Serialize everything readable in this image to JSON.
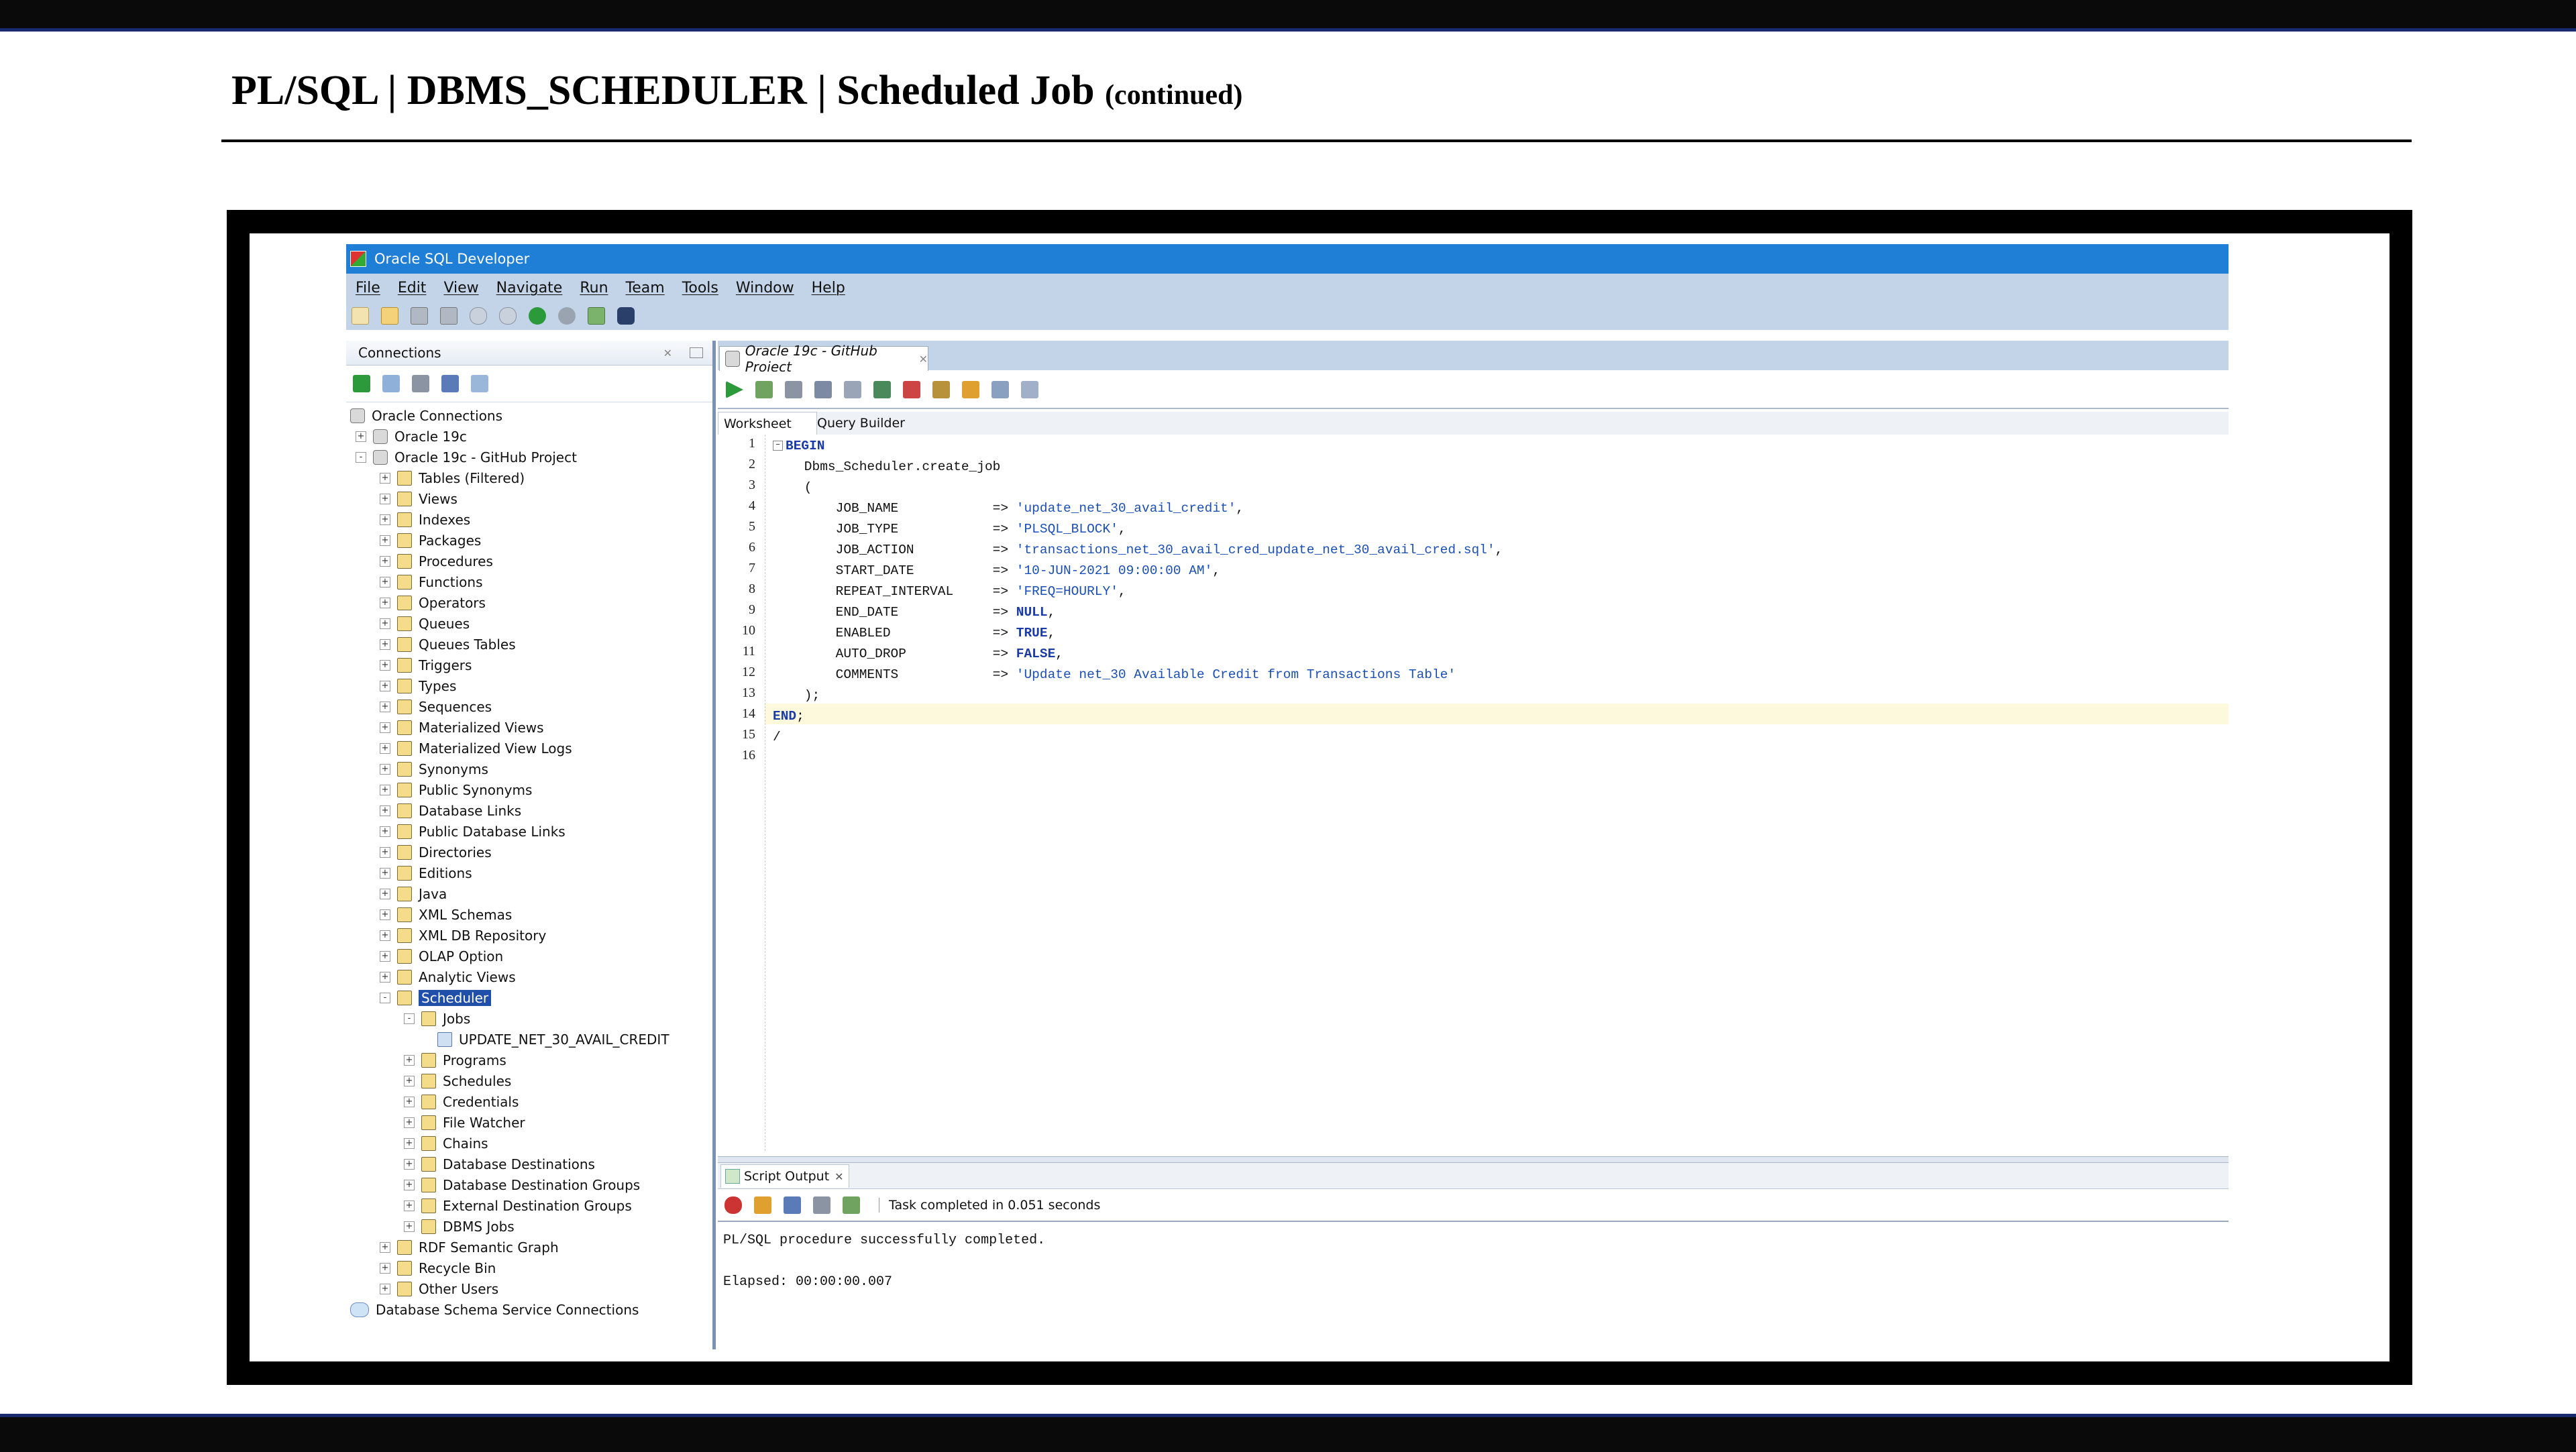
{
  "slide": {
    "title": "PL/SQL | DBMS_SCHEDULER | Scheduled Job",
    "title_suffix": "(continued)"
  },
  "app": {
    "window_title": "Oracle SQL Developer",
    "menu": [
      "File",
      "Edit",
      "View",
      "Navigate",
      "Run",
      "Team",
      "Tools",
      "Window",
      "Help"
    ]
  },
  "connections_panel": {
    "title": "Connections",
    "tree": [
      {
        "label": "Oracle Connections",
        "level": 0,
        "icon": "database-icon",
        "expander": ""
      },
      {
        "label": "Oracle 19c",
        "level": 1,
        "icon": "database-icon",
        "expander": "+"
      },
      {
        "label": "Oracle 19c - GitHub Project",
        "level": 1,
        "icon": "database-icon",
        "expander": "-"
      },
      {
        "label": "Tables (Filtered)",
        "level": 2,
        "icon": "folder-icon",
        "expander": "+"
      },
      {
        "label": "Views",
        "level": 2,
        "icon": "folder-icon",
        "expander": "+"
      },
      {
        "label": "Indexes",
        "level": 2,
        "icon": "folder-icon",
        "expander": "+"
      },
      {
        "label": "Packages",
        "level": 2,
        "icon": "folder-icon",
        "expander": "+"
      },
      {
        "label": "Procedures",
        "level": 2,
        "icon": "folder-icon",
        "expander": "+"
      },
      {
        "label": "Functions",
        "level": 2,
        "icon": "folder-icon",
        "expander": "+"
      },
      {
        "label": "Operators",
        "level": 2,
        "icon": "folder-icon",
        "expander": "+"
      },
      {
        "label": "Queues",
        "level": 2,
        "icon": "folder-icon",
        "expander": "+"
      },
      {
        "label": "Queues Tables",
        "level": 2,
        "icon": "folder-icon",
        "expander": "+"
      },
      {
        "label": "Triggers",
        "level": 2,
        "icon": "folder-icon",
        "expander": "+"
      },
      {
        "label": "Types",
        "level": 2,
        "icon": "folder-icon",
        "expander": "+"
      },
      {
        "label": "Sequences",
        "level": 2,
        "icon": "folder-icon",
        "expander": "+"
      },
      {
        "label": "Materialized Views",
        "level": 2,
        "icon": "folder-icon",
        "expander": "+"
      },
      {
        "label": "Materialized View Logs",
        "level": 2,
        "icon": "folder-icon",
        "expander": "+"
      },
      {
        "label": "Synonyms",
        "level": 2,
        "icon": "folder-icon",
        "expander": "+"
      },
      {
        "label": "Public Synonyms",
        "level": 2,
        "icon": "folder-icon",
        "expander": "+"
      },
      {
        "label": "Database Links",
        "level": 2,
        "icon": "folder-icon",
        "expander": "+"
      },
      {
        "label": "Public Database Links",
        "level": 2,
        "icon": "folder-icon",
        "expander": "+"
      },
      {
        "label": "Directories",
        "level": 2,
        "icon": "folder-icon",
        "expander": "+"
      },
      {
        "label": "Editions",
        "level": 2,
        "icon": "folder-icon",
        "expander": "+"
      },
      {
        "label": "Java",
        "level": 2,
        "icon": "folder-icon",
        "expander": "+"
      },
      {
        "label": "XML Schemas",
        "level": 2,
        "icon": "folder-icon",
        "expander": "+"
      },
      {
        "label": "XML DB Repository",
        "level": 2,
        "icon": "folder-icon",
        "expander": "+"
      },
      {
        "label": "OLAP Option",
        "level": 2,
        "icon": "folder-icon",
        "expander": "+"
      },
      {
        "label": "Analytic Views",
        "level": 2,
        "icon": "folder-icon",
        "expander": "+"
      },
      {
        "label": "Scheduler",
        "level": 2,
        "icon": "folder-icon",
        "expander": "-",
        "selected": true
      },
      {
        "label": "Jobs",
        "level": 3,
        "icon": "folder-icon",
        "expander": "-"
      },
      {
        "label": "UPDATE_NET_30_AVAIL_CREDIT",
        "level": 4,
        "icon": "job-icon",
        "expander": ""
      },
      {
        "label": "Programs",
        "level": 3,
        "icon": "folder-icon",
        "expander": "+"
      },
      {
        "label": "Schedules",
        "level": 3,
        "icon": "folder-icon",
        "expander": "+"
      },
      {
        "label": "Credentials",
        "level": 3,
        "icon": "folder-icon",
        "expander": "+"
      },
      {
        "label": "File Watcher",
        "level": 3,
        "icon": "folder-icon",
        "expander": "+"
      },
      {
        "label": "Chains",
        "level": 3,
        "icon": "folder-icon",
        "expander": "+"
      },
      {
        "label": "Database Destinations",
        "level": 3,
        "icon": "folder-icon",
        "expander": "+"
      },
      {
        "label": "Database Destination Groups",
        "level": 3,
        "icon": "folder-icon",
        "expander": "+"
      },
      {
        "label": "External Destination Groups",
        "level": 3,
        "icon": "folder-icon",
        "expander": "+"
      },
      {
        "label": "DBMS Jobs",
        "level": 3,
        "icon": "folder-icon",
        "expander": "+"
      },
      {
        "label": "RDF Semantic Graph",
        "level": 2,
        "icon": "folder-icon",
        "expander": "+"
      },
      {
        "label": "Recycle Bin",
        "level": 2,
        "icon": "folder-icon",
        "expander": "+"
      },
      {
        "label": "Other Users",
        "level": 2,
        "icon": "folder-icon",
        "expander": "+"
      },
      {
        "label": "Database Schema Service Connections",
        "level": 0,
        "icon": "cloud-icon",
        "expander": ""
      }
    ]
  },
  "editor": {
    "tab_label": "Oracle 19c - GitHub Project",
    "subtabs": [
      "Worksheet",
      "Query Builder"
    ],
    "code_lines": [
      "BEGIN",
      "    Dbms_Scheduler.create_job",
      "    (",
      "        JOB_NAME            => 'update_net_30_avail_credit',",
      "        JOB_TYPE            => 'PLSQL_BLOCK',",
      "        JOB_ACTION          => 'transactions_net_30_avail_cred_update_net_30_avail_cred.sql',",
      "        START_DATE          => '10-JUN-2021 09:00:00 AM',",
      "        REPEAT_INTERVAL     => 'FREQ=HOURLY',",
      "        END_DATE            => NULL,",
      "        ENABLED             => TRUE,",
      "        AUTO_DROP           => FALSE,",
      "        COMMENTS            => 'Update net_30 Available Credit from Transactions Table'",
      "    );",
      "END;",
      "/",
      ""
    ],
    "current_line": 15
  },
  "output": {
    "tab_label": "Script Output",
    "status": "Task completed in 0.051 seconds",
    "lines": [
      "PL/SQL procedure successfully completed.",
      "",
      "Elapsed: 00:00:00.007"
    ]
  }
}
